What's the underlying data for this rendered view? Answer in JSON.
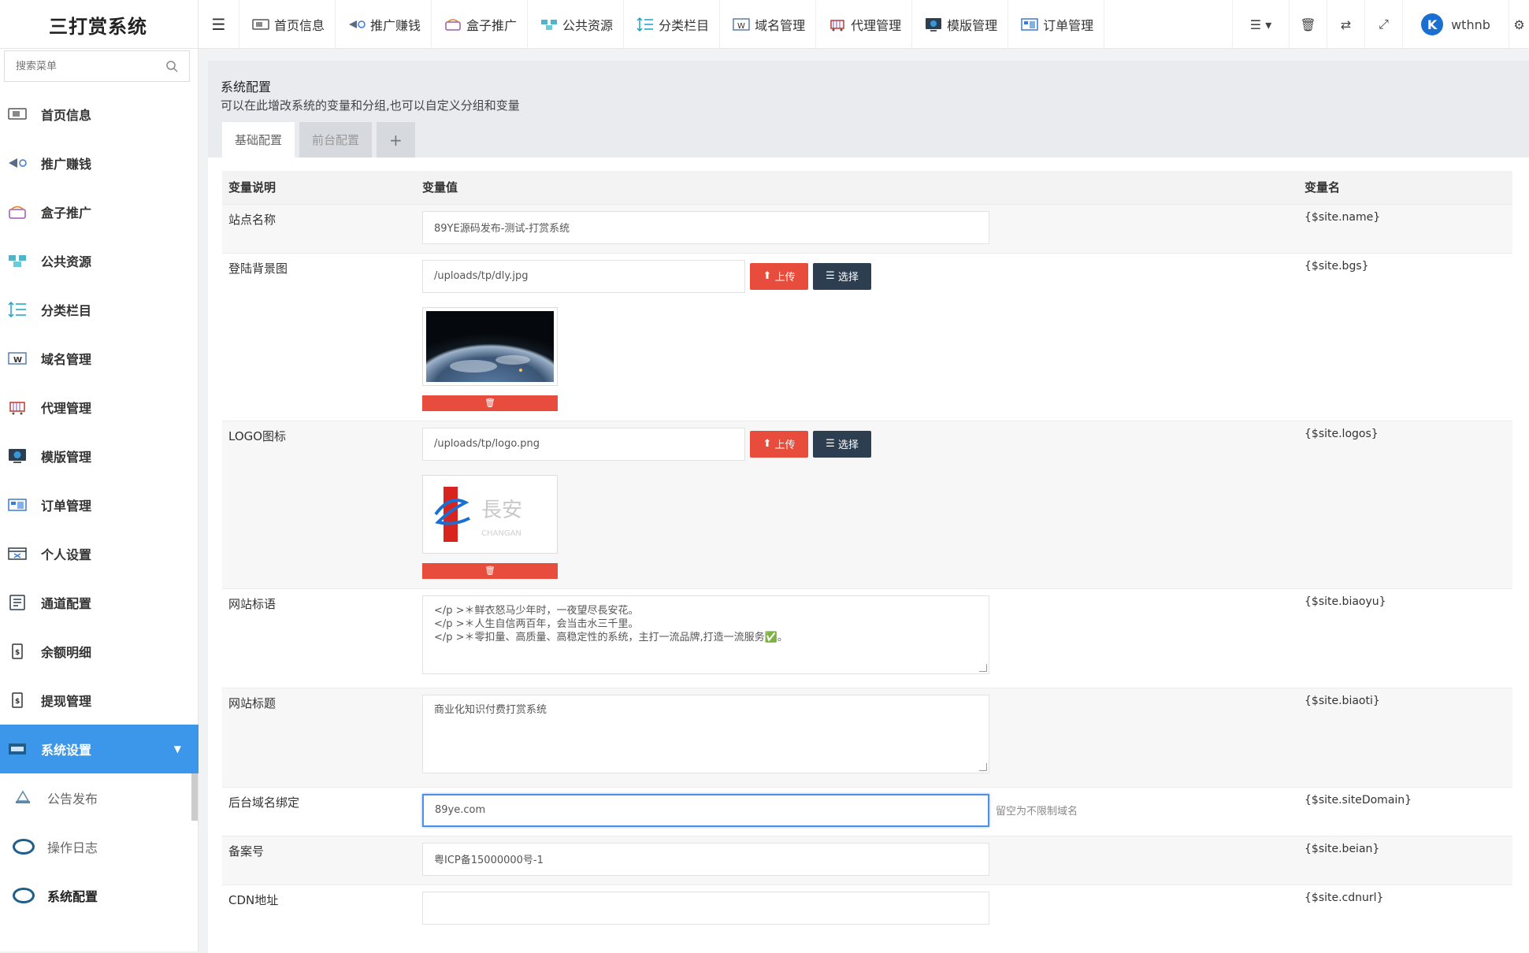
{
  "brand": "三打赏系统",
  "topnav": [
    {
      "label": "首页信息",
      "icon": "home-monitor-icon"
    },
    {
      "label": "推广赚钱",
      "icon": "promo-icon"
    },
    {
      "label": "盒子推广",
      "icon": "box-icon"
    },
    {
      "label": "公共资源",
      "icon": "resource-icon"
    },
    {
      "label": "分类栏目",
      "icon": "category-icon"
    },
    {
      "label": "域名管理",
      "icon": "domain-icon"
    },
    {
      "label": "代理管理",
      "icon": "agent-icon"
    },
    {
      "label": "模版管理",
      "icon": "template-icon"
    },
    {
      "label": "订单管理",
      "icon": "order-icon"
    }
  ],
  "user": {
    "name": "wthnb",
    "avatar_letter": "K"
  },
  "search": {
    "placeholder": "搜索菜单"
  },
  "sidebar": {
    "items": [
      {
        "label": "首页信息",
        "icon": "home-monitor-icon"
      },
      {
        "label": "推广赚钱",
        "icon": "promo-icon"
      },
      {
        "label": "盒子推广",
        "icon": "box-icon"
      },
      {
        "label": "公共资源",
        "icon": "resource-icon"
      },
      {
        "label": "分类栏目",
        "icon": "category-icon"
      },
      {
        "label": "域名管理",
        "icon": "domain-icon"
      },
      {
        "label": "代理管理",
        "icon": "agent-icon"
      },
      {
        "label": "模版管理",
        "icon": "template-icon"
      },
      {
        "label": "订单管理",
        "icon": "order-icon"
      },
      {
        "label": "个人设置",
        "icon": "personal-icon"
      },
      {
        "label": "通道配置",
        "icon": "channel-icon"
      },
      {
        "label": "余额明细",
        "icon": "balance-icon"
      },
      {
        "label": "提现管理",
        "icon": "withdraw-icon"
      },
      {
        "label": "系统设置",
        "icon": "settings-icon"
      }
    ],
    "subitems": [
      "公告发布",
      "操作日志",
      "系统配置"
    ]
  },
  "page": {
    "title": "系统配置",
    "subtitle": "可以在此增改系统的变量和分组,也可以自定义分组和变量"
  },
  "tabs": [
    "基础配置",
    "前台配置",
    "+"
  ],
  "table": {
    "headers": [
      "变量说明",
      "变量值",
      "变量名"
    ],
    "rows": [
      {
        "desc": "站点名称",
        "value": "89YE源码发布-测试-打赏系统",
        "var": "{$site.name}"
      },
      {
        "desc": "登陆背景图",
        "value": "/uploads/tp/dly.jpg",
        "var": "{$site.bgs}"
      },
      {
        "desc": "LOGO图标",
        "value": "/uploads/tp/logo.png",
        "var": "{$site.logos}"
      },
      {
        "desc": "网站标语",
        "value_lines": [
          "</p >＊鲜衣怒马少年时，一夜望尽長安花。",
          "</p >＊人生自信两百年，会当击水三千里。",
          "</p >＊零扣量、高质量、高稳定性的系统，主打一流品牌,打造一流服务✅。"
        ],
        "var": "{$site.biaoyu}"
      },
      {
        "desc": "网站标题",
        "value": "商业化知识付费打赏系统",
        "var": "{$site.biaoti}"
      },
      {
        "desc": "后台域名绑定",
        "value": "89ye.com",
        "hint": "留空为不限制域名",
        "var": "{$site.siteDomain}"
      },
      {
        "desc": "备案号",
        "value": "粤ICP备15000000号-1",
        "var": "{$site.beian}"
      },
      {
        "desc": "CDN地址",
        "value": "",
        "var": "{$site.cdnurl}"
      }
    ]
  },
  "buttons": {
    "upload": "上传",
    "choose": "选择"
  },
  "logo_text": {
    "cn": "長安",
    "en": "CHANGAN"
  },
  "colors": {
    "accent": "#3c97ea",
    "danger": "#e74c3c",
    "dark": "#2c3e50"
  }
}
